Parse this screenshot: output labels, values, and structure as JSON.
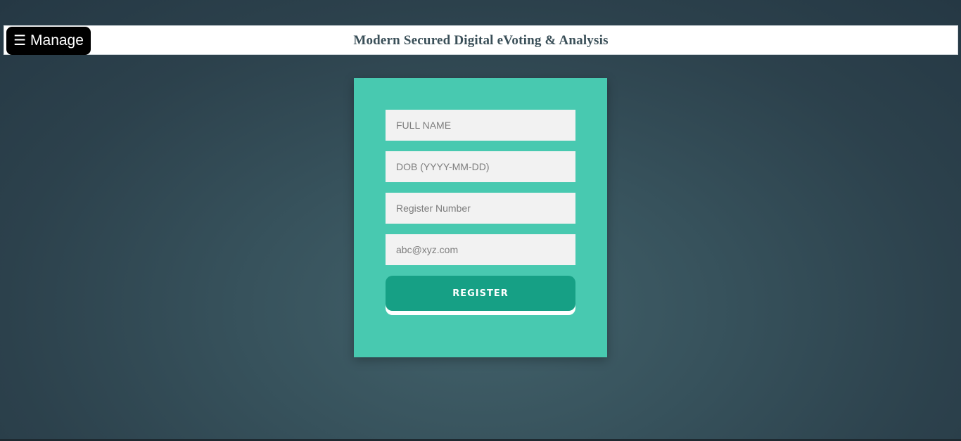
{
  "header": {
    "menu_icon": "☰",
    "manage_label": "Manage",
    "title": "Modern Secured Digital eVoting & Analysis"
  },
  "form": {
    "full_name": {
      "placeholder": "FULL NAME",
      "value": ""
    },
    "dob": {
      "placeholder": "DOB (YYYY-MM-DD)",
      "value": ""
    },
    "register_number": {
      "placeholder": "Register Number",
      "value": ""
    },
    "email": {
      "placeholder": "abc@xyz.com",
      "value": ""
    },
    "register_label": "REGISTER"
  },
  "colors": {
    "background": "#37525c",
    "card": "#48c9b0",
    "button": "#16a085",
    "input_bg": "#f2f2f2",
    "title": "#3a4f58",
    "manage_bg": "#000000"
  }
}
